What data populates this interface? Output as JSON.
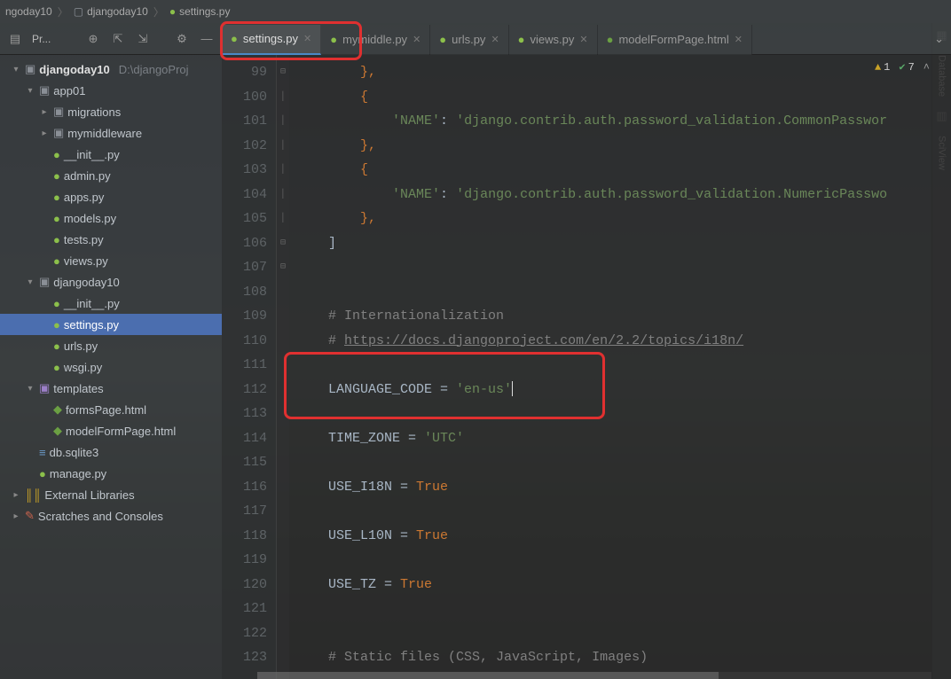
{
  "breadcrumb": {
    "items": [
      "ngoday10",
      "djangoday10",
      "settings.py"
    ]
  },
  "project_tool": {
    "label": "Pr..."
  },
  "tabs": [
    {
      "label": "settings.py",
      "type": "py",
      "active": true
    },
    {
      "label": "mymiddle.py",
      "type": "py",
      "active": false
    },
    {
      "label": "urls.py",
      "type": "py",
      "active": false
    },
    {
      "label": "views.py",
      "type": "py",
      "active": false
    },
    {
      "label": "modelFormPage.html",
      "type": "html",
      "active": false
    }
  ],
  "inspections": {
    "warnings": "1",
    "oks": "7"
  },
  "tree": [
    {
      "depth": 0,
      "chev": "▾",
      "icon": "folder",
      "label": "djangoday10",
      "suffix": "D:\\djangoProj",
      "bold": true
    },
    {
      "depth": 1,
      "chev": "▾",
      "icon": "folder",
      "label": "app01"
    },
    {
      "depth": 2,
      "chev": "▸",
      "icon": "folder",
      "label": "migrations"
    },
    {
      "depth": 2,
      "chev": "▸",
      "icon": "folder",
      "label": "mymiddleware"
    },
    {
      "depth": 2,
      "chev": "",
      "icon": "py",
      "label": "__init__.py"
    },
    {
      "depth": 2,
      "chev": "",
      "icon": "py",
      "label": "admin.py"
    },
    {
      "depth": 2,
      "chev": "",
      "icon": "py",
      "label": "apps.py"
    },
    {
      "depth": 2,
      "chev": "",
      "icon": "py",
      "label": "models.py"
    },
    {
      "depth": 2,
      "chev": "",
      "icon": "py",
      "label": "tests.py"
    },
    {
      "depth": 2,
      "chev": "",
      "icon": "py",
      "label": "views.py"
    },
    {
      "depth": 1,
      "chev": "▾",
      "icon": "folder",
      "label": "djangoday10"
    },
    {
      "depth": 2,
      "chev": "",
      "icon": "py",
      "label": "__init__.py"
    },
    {
      "depth": 2,
      "chev": "",
      "icon": "py",
      "label": "settings.py",
      "selected": true
    },
    {
      "depth": 2,
      "chev": "",
      "icon": "py",
      "label": "urls.py"
    },
    {
      "depth": 2,
      "chev": "",
      "icon": "py",
      "label": "wsgi.py"
    },
    {
      "depth": 1,
      "chev": "▾",
      "icon": "folder-purple",
      "label": "templates"
    },
    {
      "depth": 2,
      "chev": "",
      "icon": "html",
      "label": "formsPage.html"
    },
    {
      "depth": 2,
      "chev": "",
      "icon": "html",
      "label": "modelFormPage.html"
    },
    {
      "depth": 1,
      "chev": "",
      "icon": "db",
      "label": "db.sqlite3"
    },
    {
      "depth": 1,
      "chev": "",
      "icon": "py",
      "label": "manage.py"
    },
    {
      "depth": 0,
      "chev": "▸",
      "icon": "lib",
      "label": "External Libraries"
    },
    {
      "depth": 0,
      "chev": "▸",
      "icon": "scratch",
      "label": "Scratches and Consoles"
    }
  ],
  "right_rails": {
    "items": [
      "Database",
      "SciView"
    ]
  },
  "gutter": {
    "start": 99,
    "end": 123
  },
  "code": {
    "lines": [
      {
        "raw": "        },",
        "cls": "orange"
      },
      {
        "raw": "        {",
        "cls": "orange"
      },
      {
        "segs": [
          [
            "            ",
            ""
          ],
          [
            "'NAME'",
            "str"
          ],
          [
            ": ",
            ""
          ],
          [
            "'django.contrib.auth.password_validation.CommonPasswor",
            "str"
          ]
        ]
      },
      {
        "raw": "        },",
        "cls": "orange"
      },
      {
        "raw": "        {",
        "cls": "orange"
      },
      {
        "segs": [
          [
            "            ",
            ""
          ],
          [
            "'NAME'",
            "str"
          ],
          [
            ": ",
            ""
          ],
          [
            "'django.contrib.auth.password_validation.NumericPasswo",
            "str"
          ]
        ]
      },
      {
        "raw": "        },",
        "cls": "orange"
      },
      {
        "raw": "    ]",
        "cls": ""
      },
      {
        "raw": "",
        "cls": ""
      },
      {
        "raw": "",
        "cls": ""
      },
      {
        "segs": [
          [
            "    ",
            ""
          ],
          [
            "# Internationalization",
            "cmt"
          ]
        ]
      },
      {
        "segs": [
          [
            "    ",
            ""
          ],
          [
            "# ",
            "cmt"
          ],
          [
            "https://docs.djangoproject.com/en/2.2/topics/i18n/",
            "cmt link"
          ]
        ]
      },
      {
        "raw": "",
        "cls": ""
      },
      {
        "segs": [
          [
            "    LANGUAGE_CODE = ",
            ""
          ],
          [
            "'en-us'",
            "str"
          ]
        ],
        "caret": true
      },
      {
        "raw": "",
        "cls": ""
      },
      {
        "segs": [
          [
            "    TIME_ZONE = ",
            ""
          ],
          [
            "'UTC'",
            "str"
          ]
        ]
      },
      {
        "raw": "",
        "cls": ""
      },
      {
        "segs": [
          [
            "    USE_I18N = ",
            ""
          ],
          [
            "True",
            "kw"
          ]
        ]
      },
      {
        "raw": "",
        "cls": ""
      },
      {
        "segs": [
          [
            "    USE_L10N = ",
            ""
          ],
          [
            "True",
            "kw"
          ]
        ]
      },
      {
        "raw": "",
        "cls": ""
      },
      {
        "segs": [
          [
            "    USE_TZ = ",
            ""
          ],
          [
            "True",
            "kw"
          ]
        ]
      },
      {
        "raw": "",
        "cls": ""
      },
      {
        "raw": "",
        "cls": ""
      },
      {
        "segs": [
          [
            "    ",
            ""
          ],
          [
            "# Static files (CSS, JavaScript, Images)",
            "cmt"
          ]
        ]
      }
    ]
  }
}
